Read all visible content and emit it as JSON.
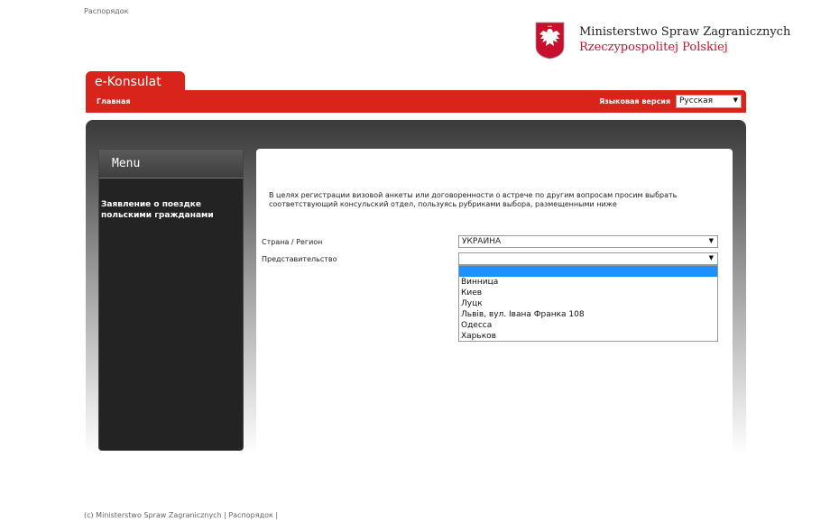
{
  "top": {
    "link": "Распорядок"
  },
  "logo": {
    "line1": "Ministerstwo Spraw Zagranicznych",
    "line2": "Rzeczypospolitej Polskiej",
    "icon": "polish-eagle-emblem"
  },
  "header": {
    "tab_label": "e-Konsulat",
    "home_label": "Главная",
    "lang_label": "Языковая версия",
    "lang_value": "Русская"
  },
  "sidebar": {
    "title": "Menu",
    "items": [
      {
        "label": "Заявление о поездке польскими гражданами"
      }
    ]
  },
  "form": {
    "intro": "В целях регистрации визовой анкеты или договоренности о встрече по другим вопросам просим выбрать соответствующий консульский отдел, пользуясь рубриками выбора, размещенными ниже",
    "country_label": "Страна / Регион",
    "country_value": "УКРАИНА",
    "office_label": "Представительство",
    "office_value": "",
    "office_options": [
      "",
      "Винница",
      "Киев",
      "Луцк",
      "Львів, вул. Івана Франка 108",
      "Одесса",
      "Харьков"
    ]
  },
  "footer": {
    "text": "(c) Ministerstwo Spraw Zagranicznych | Распорядок |"
  },
  "colors": {
    "brand_red": "#d8241b",
    "highlight": "#1e90ff"
  }
}
